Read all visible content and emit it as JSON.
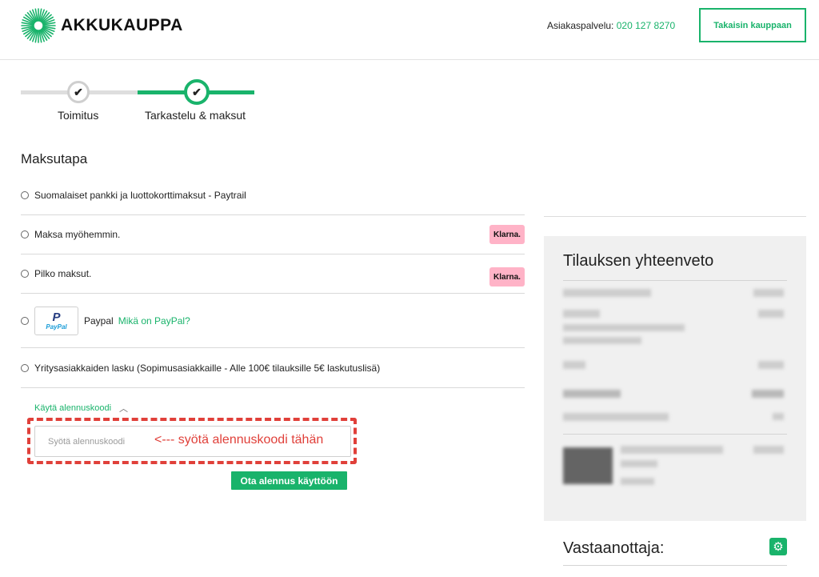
{
  "header": {
    "logo_text": "AKKUKAUPPA",
    "customer_service_label": "Asiakaspalvelu:",
    "customer_service_phone": "020 127 8270",
    "back_button": "Takaisin kauppaan"
  },
  "progress": {
    "steps": [
      {
        "label": "Toimitus",
        "status": "completed"
      },
      {
        "label": "Tarkastelu & maksut",
        "status": "active"
      }
    ]
  },
  "payment": {
    "title": "Maksutapa",
    "options": [
      {
        "label": "Suomalaiset pankki ja luottokorttimaksut - Paytrail"
      },
      {
        "label": "Maksa myöhemmin.",
        "badge": "Klarna."
      },
      {
        "label": "Pilko maksut.",
        "badge": "Klarna."
      },
      {
        "label": "Paypal",
        "link": "Mikä on PayPal?",
        "logo_top": "P",
        "logo_word": "PayPal"
      },
      {
        "label": "Yritysasiakkaiden lasku (Sopimusasiakkaille - Alle 100€ tilauksille 5€ laskutuslisä)"
      }
    ]
  },
  "discount": {
    "toggle_label": "Käytä alennuskoodi",
    "input_placeholder": "Syötä alennuskoodi",
    "input_value": "",
    "annotation": "<--- syötä alennuskoodi tähän",
    "apply_button": "Ota alennus käyttöön"
  },
  "summary": {
    "title": "Tilauksen yhteenveto"
  },
  "recipient": {
    "title": "Vastaanottaja:"
  },
  "colors": {
    "accent": "#19b36b",
    "annotation": "#e0403a",
    "klarna_pink": "#ffb3c7",
    "summary_bg": "#f0f0f0"
  },
  "icons": [
    "logo-burst-icon",
    "check-icon",
    "chevron-up-icon",
    "gear-icon",
    "paypal-logo-icon"
  ]
}
